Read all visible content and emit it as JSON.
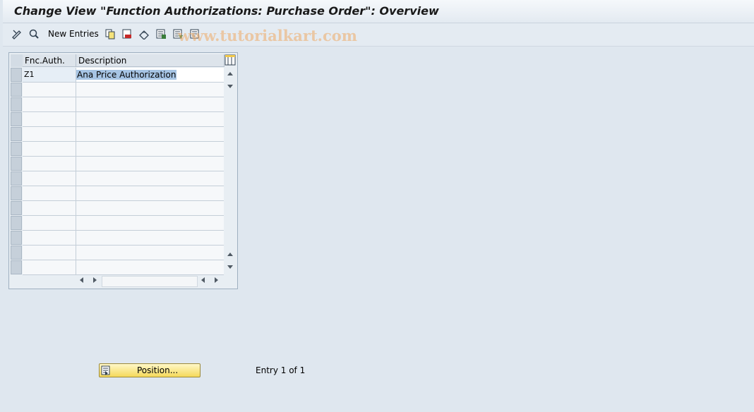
{
  "window": {
    "title": "Change View \"Function Authorizations: Purchase Order\": Overview"
  },
  "toolbar": {
    "icons": [
      "display-change-icon",
      "other-view-icon",
      "copy-as-icon",
      "delete-icon",
      "undo-change-icon",
      "select-all-icon",
      "select-block-icon",
      "deselect-all-icon"
    ],
    "new_entries_label": "New Entries",
    "watermark": "www.tutorialkart.com"
  },
  "table": {
    "columns": [
      "Fnc.Auth.",
      "Description"
    ],
    "rows": [
      {
        "fnc_auth": "Z1",
        "description": "Ana Price Authorization"
      }
    ],
    "empty_row_count": 13
  },
  "footer": {
    "position_button_label": "Position...",
    "entry_count": "Entry 1 of 1"
  },
  "colors": {
    "background": "#dfe7ef",
    "button_yellow": "#f5d95a",
    "selection_blue": "#a6c4e4"
  }
}
